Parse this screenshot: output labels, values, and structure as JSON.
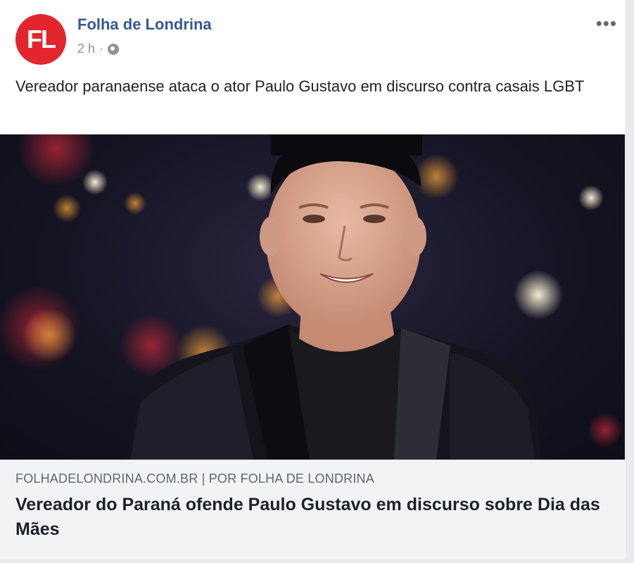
{
  "post": {
    "page_name": "Folha de Londrina",
    "avatar_initials": "FL",
    "timestamp": "2 h",
    "separator": "·",
    "audience_icon": "globe-icon",
    "more_label": "•••",
    "text": "Vereador paranaense ataca o ator Paulo Gustavo em discurso contra casais LGBT"
  },
  "link": {
    "source": "FOLHADELONDRINA.COM.BR | POR FOLHA DE LONDRINA",
    "title": "Vereador do Paraná ofende Paulo Gustavo em discurso sobre Dia das Mães"
  },
  "colors": {
    "brand": "#e3262e",
    "name_link": "#365899",
    "meta_gray": "#90949c",
    "link_bg": "#f2f3f5"
  }
}
